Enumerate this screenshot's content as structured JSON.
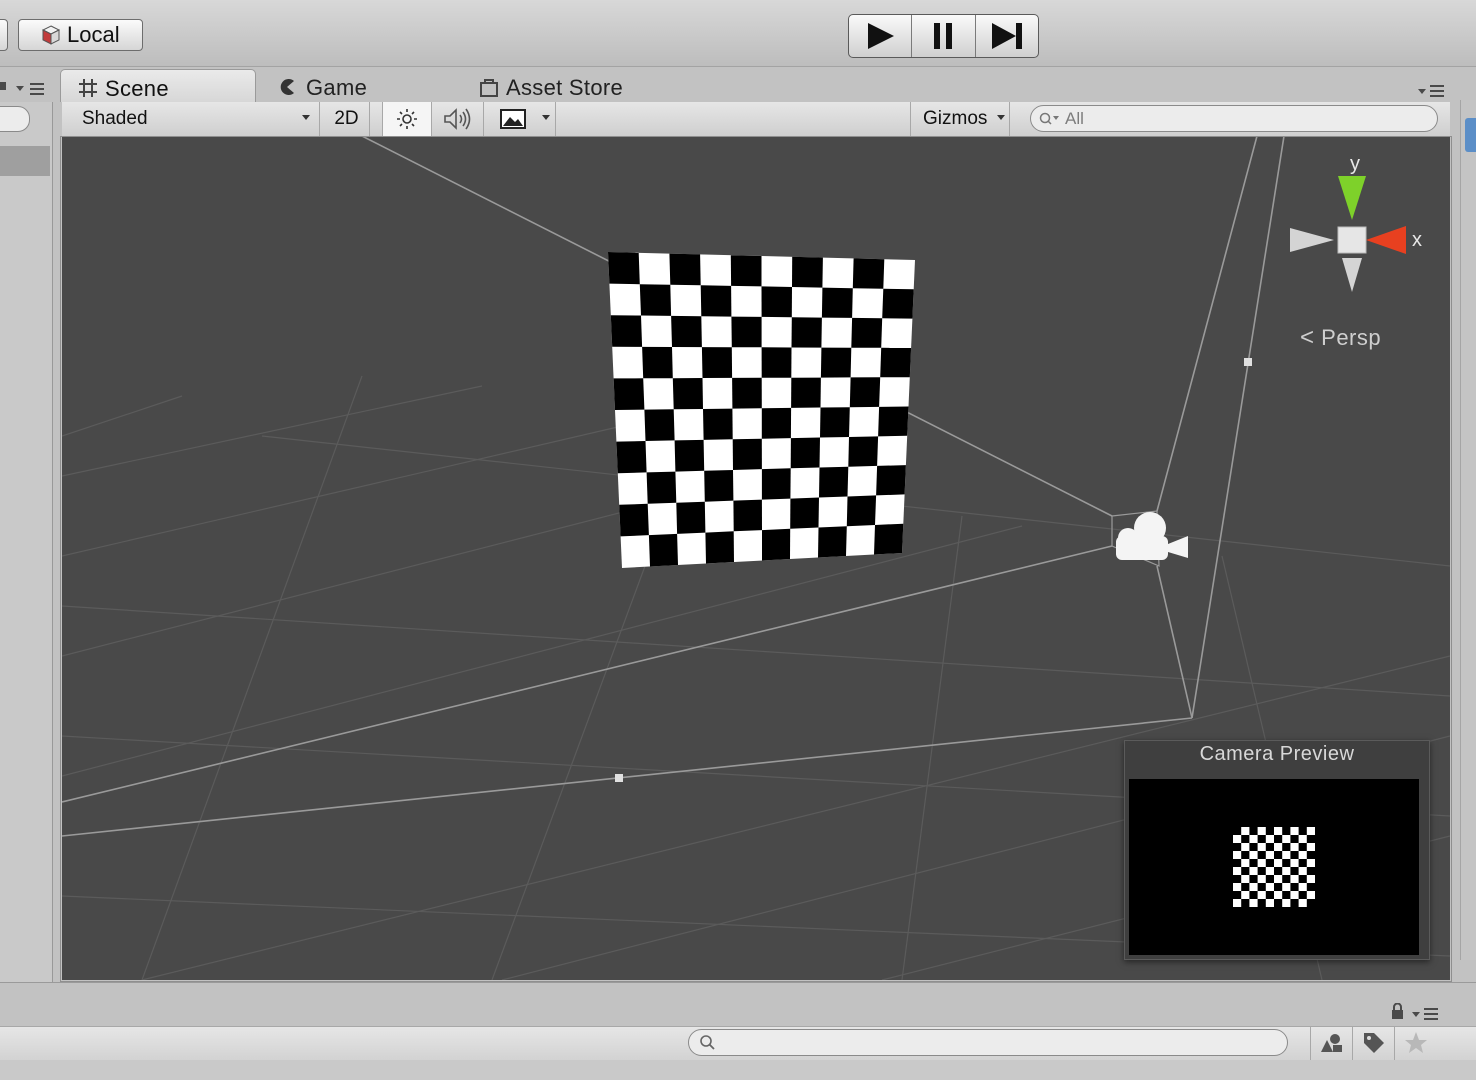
{
  "toolbar": {
    "pivot_rotation_label": "Local",
    "play_controls": [
      "play-icon",
      "pause-icon",
      "step-icon"
    ]
  },
  "tabs": [
    {
      "label": "Scene",
      "icon": "scene-grid-icon",
      "active": true
    },
    {
      "label": "Game",
      "icon": "game-pacman-icon",
      "active": false
    },
    {
      "label": "Asset Store",
      "icon": "asset-store-bag-icon",
      "active": false
    }
  ],
  "scene_bar": {
    "shading_mode": "Shaded",
    "mode_2d_label": "2D",
    "gizmos_label": "Gizmos",
    "search_placeholder": "All"
  },
  "viewport": {
    "projection_label": "Persp",
    "axis_labels": {
      "y": "y",
      "x": "x"
    },
    "camera_preview_title": "Camera Preview"
  },
  "colors": {
    "viewport_bg": "#494949",
    "axis_y": "#7ed12a",
    "axis_x": "#e84020",
    "checker_dark": "#000000",
    "checker_light": "#ffffff"
  }
}
